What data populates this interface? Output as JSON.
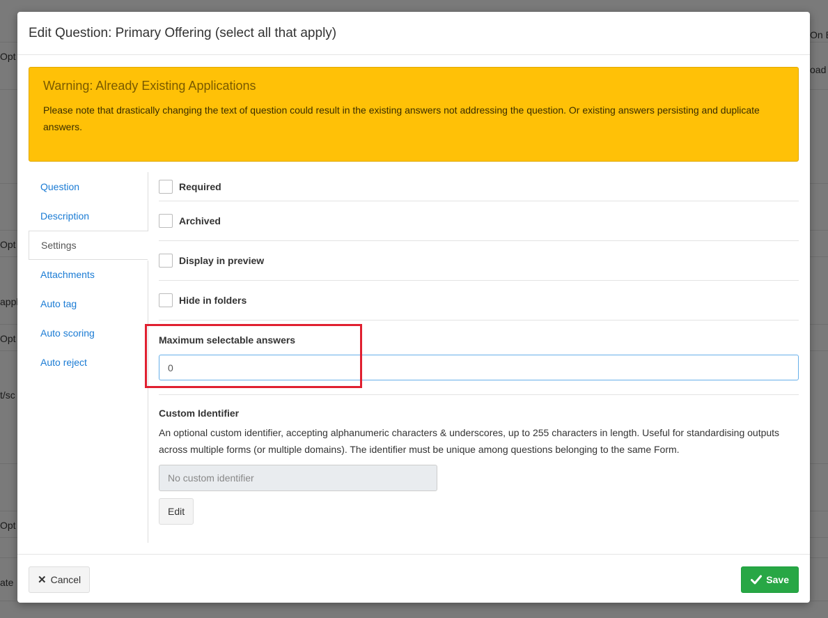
{
  "background": {
    "fragments": [
      "Opt",
      "On B",
      "oad I",
      "Opt",
      "appl",
      "Opt",
      "t/sc",
      "Opt",
      "ate"
    ]
  },
  "modal": {
    "title": "Edit Question: Primary Offering (select all that apply)",
    "warning": {
      "title": "Warning: Already Existing Applications",
      "text": "Please note that drastically changing the text of question could result in the existing answers not addressing the question. Or existing answers persisting and duplicate answers."
    },
    "sidebar": {
      "items": [
        {
          "label": "Question"
        },
        {
          "label": "Description"
        },
        {
          "label": "Settings"
        },
        {
          "label": "Attachments"
        },
        {
          "label": "Auto tag"
        },
        {
          "label": "Auto scoring"
        },
        {
          "label": "Auto reject"
        }
      ],
      "active": "Settings"
    },
    "settings": {
      "checkboxes": [
        {
          "label": "Required",
          "checked": false
        },
        {
          "label": "Archived",
          "checked": false
        },
        {
          "label": "Display in preview",
          "checked": false
        },
        {
          "label": "Hide in folders",
          "checked": false
        }
      ],
      "max_answers": {
        "label": "Maximum selectable answers",
        "value": "0"
      },
      "custom_identifier": {
        "label": "Custom Identifier",
        "description": "An optional custom identifier, accepting alphanumeric characters & underscores, up to 255 characters in length. Useful for standardising outputs across multiple forms (or multiple domains). The identifier must be unique among questions belonging to the same Form.",
        "placeholder": "No custom identifier",
        "edit_label": "Edit"
      }
    },
    "footer": {
      "cancel_label": "Cancel",
      "save_label": "Save"
    }
  },
  "colors": {
    "warning_bg": "#ffc107",
    "link": "#1a7bd4",
    "save_bg": "#28a745",
    "highlight": "#e02030"
  }
}
